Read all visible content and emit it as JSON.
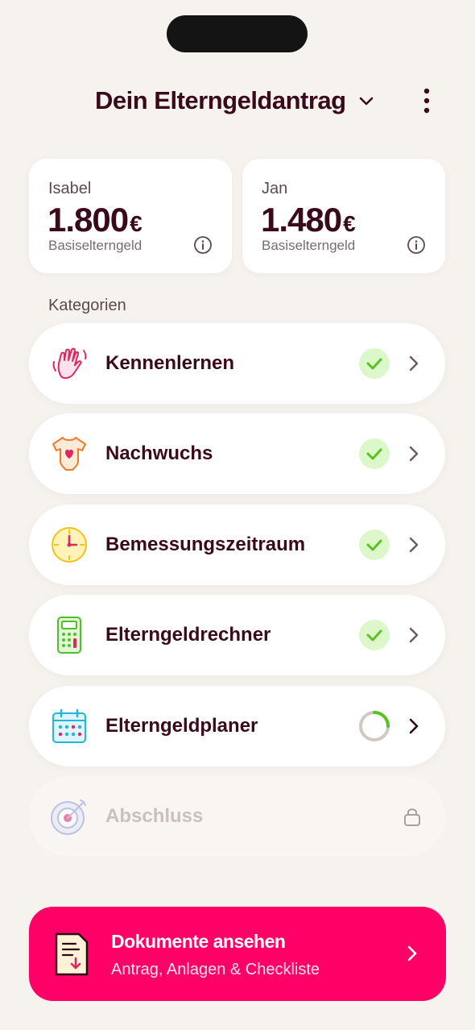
{
  "header": {
    "title": "Dein Elterngeldantrag",
    "dropdown_icon": "chevron-down-icon",
    "menu_icon": "more-vertical-icon"
  },
  "parents": [
    {
      "name": "Isabel",
      "amount": "1.800",
      "currency": "€",
      "type": "Basiselterngeld"
    },
    {
      "name": "Jan",
      "amount": "1.480",
      "currency": "€",
      "type": "Basiselterngeld"
    }
  ],
  "categories_label": "Kategorien",
  "categories": [
    {
      "label": "Kennenlernen",
      "icon": "waving-hand-icon",
      "status": "complete"
    },
    {
      "label": "Nachwuchs",
      "icon": "baby-bodysuit-icon",
      "status": "complete"
    },
    {
      "label": "Bemessungszeitraum",
      "icon": "clock-icon",
      "status": "complete"
    },
    {
      "label": "Elterngeldrechner",
      "icon": "calculator-icon",
      "status": "complete"
    },
    {
      "label": "Elterngeldplaner",
      "icon": "calendar-icon",
      "status": "in-progress",
      "progress": 0.25
    },
    {
      "label": "Abschluss",
      "icon": "target-icon",
      "status": "locked"
    }
  ],
  "documents": {
    "title": "Dokumente ansehen",
    "subtitle": "Antrag, Anlagen & Checkliste",
    "icon": "document-download-icon"
  },
  "colors": {
    "background": "#f6f2ee",
    "text": "#3a0a1c",
    "accent": "#ff0066",
    "check_bg": "#dcf7c9",
    "check": "#58c322"
  }
}
